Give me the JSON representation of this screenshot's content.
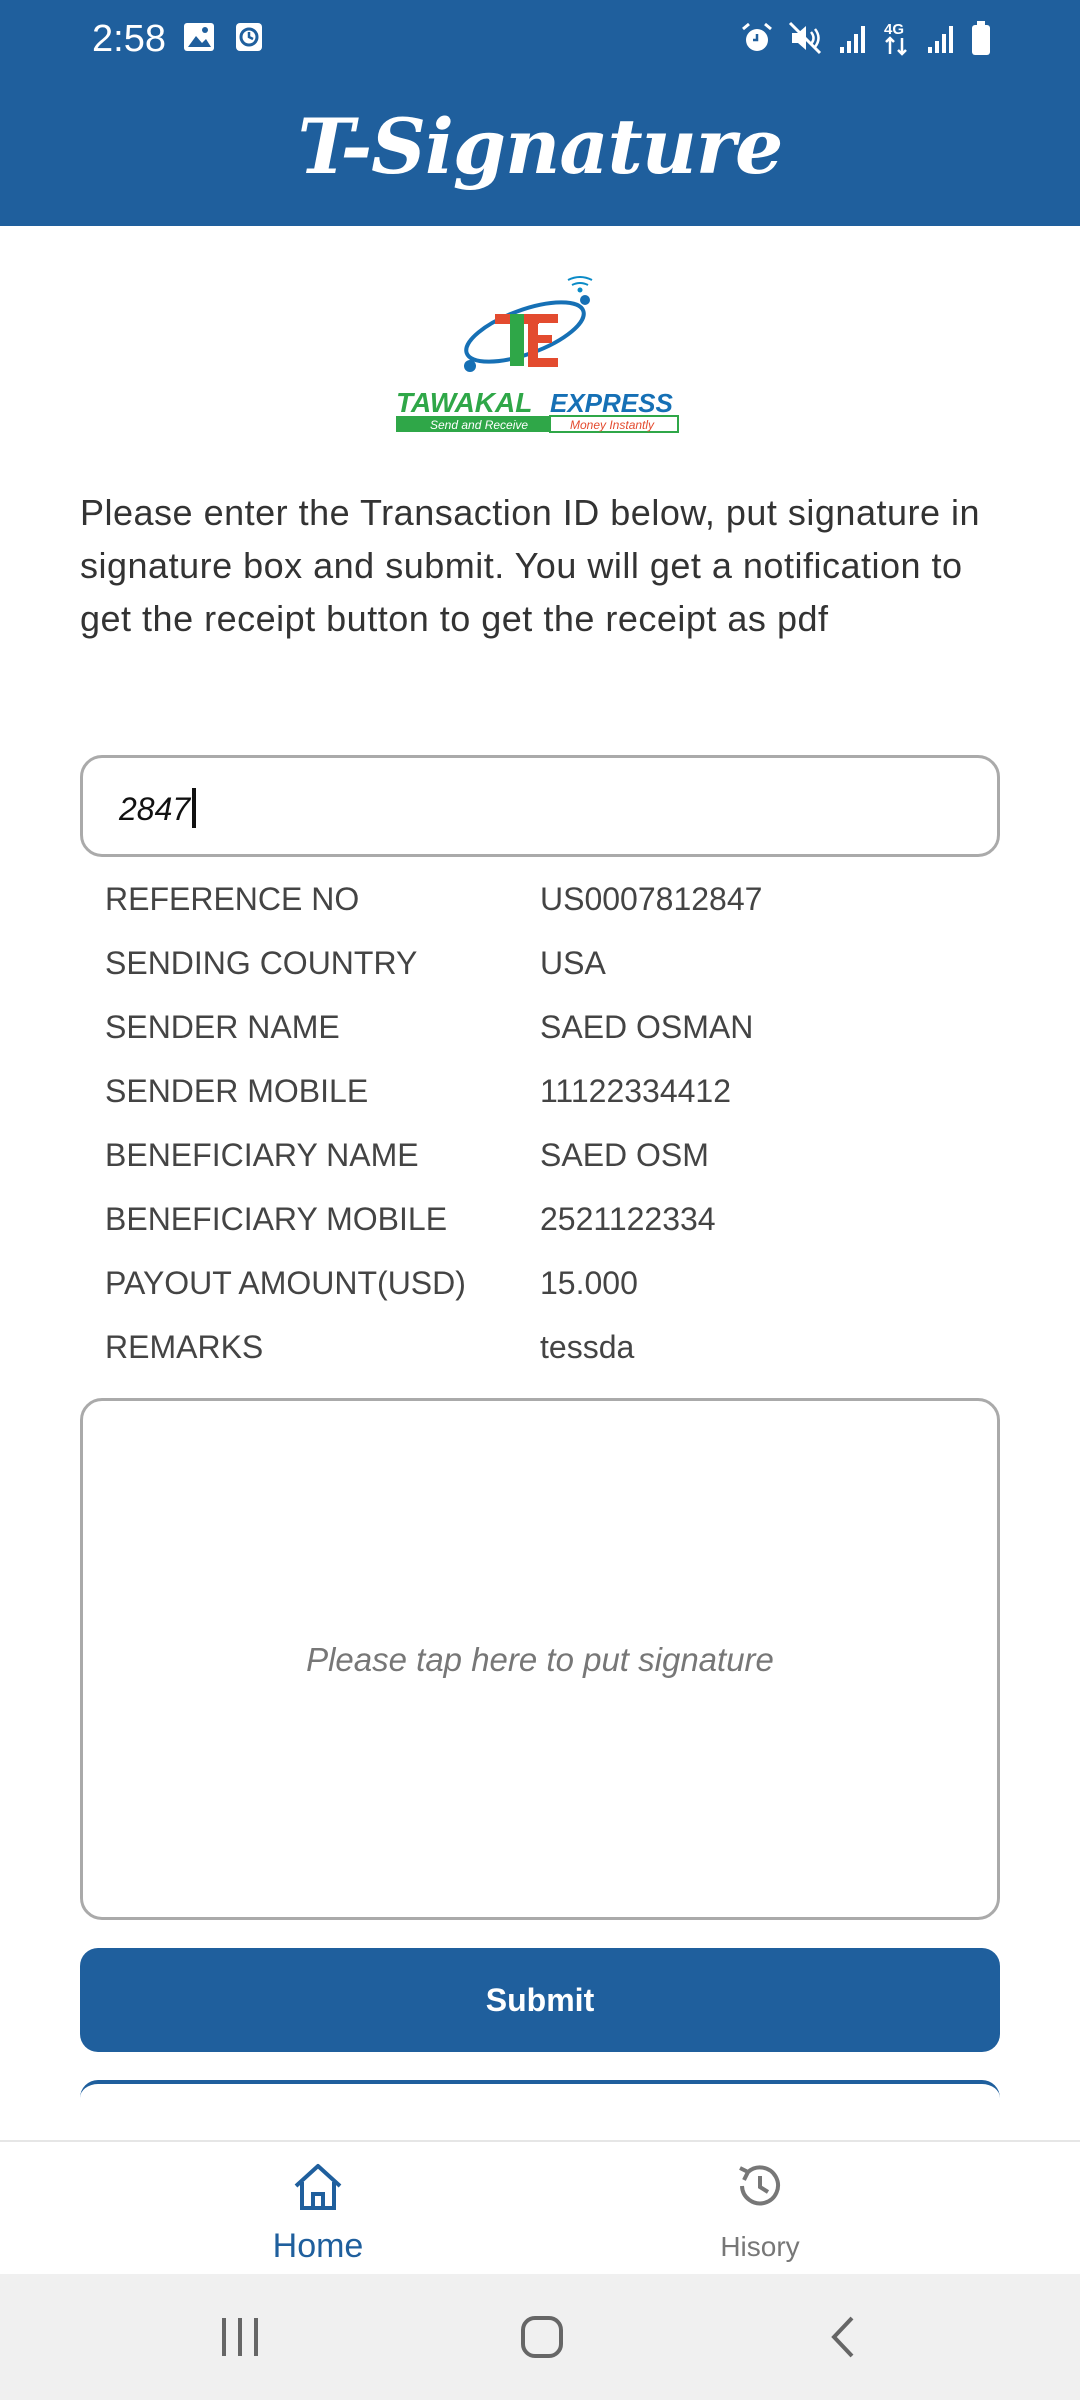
{
  "status_bar": {
    "time": "2:58",
    "left_icons": [
      "image-icon",
      "clock-app-icon"
    ],
    "right_icons": [
      "alarm-icon",
      "mute-icon",
      "signal-icon",
      "4g-icon",
      "signal-icon",
      "battery-icon"
    ],
    "network_label": "4G"
  },
  "header": {
    "title": "T-Signature",
    "color": "#1f5f9d"
  },
  "logo": {
    "letters": "TE",
    "brand_left": "TAWAKAL",
    "brand_right": "EXPRESS",
    "tagline_left": "Send and Receive",
    "tagline_right": "Money Instantly"
  },
  "instructions": "Please enter the Transaction ID below, put signature in signature box and submit. You will get a notification to get the receipt button to get the receipt as pdf",
  "transaction_input": {
    "value": "2847"
  },
  "details": [
    {
      "label": "REFERENCE NO",
      "value": "US0007812847"
    },
    {
      "label": "SENDING COUNTRY",
      "value": "USA"
    },
    {
      "label": "SENDER NAME",
      "value": "SAED OSMAN"
    },
    {
      "label": "SENDER MOBILE",
      "value": "11122334412"
    },
    {
      "label": "BENEFICIARY NAME",
      "value": "SAED OSM"
    },
    {
      "label": "BENEFICIARY MOBILE",
      "value": "2521122334"
    },
    {
      "label": "PAYOUT AMOUNT(USD)",
      "value": "15.000"
    },
    {
      "label": "REMARKS",
      "value": "tessda"
    }
  ],
  "signature": {
    "placeholder": "Please tap here to put signature"
  },
  "submit_label": "Submit",
  "bottom_nav": {
    "home_label": "Home",
    "history_label": "Hisory",
    "active": "home"
  },
  "system_nav": [
    "recent-apps-icon",
    "home-circle-icon",
    "back-icon"
  ]
}
